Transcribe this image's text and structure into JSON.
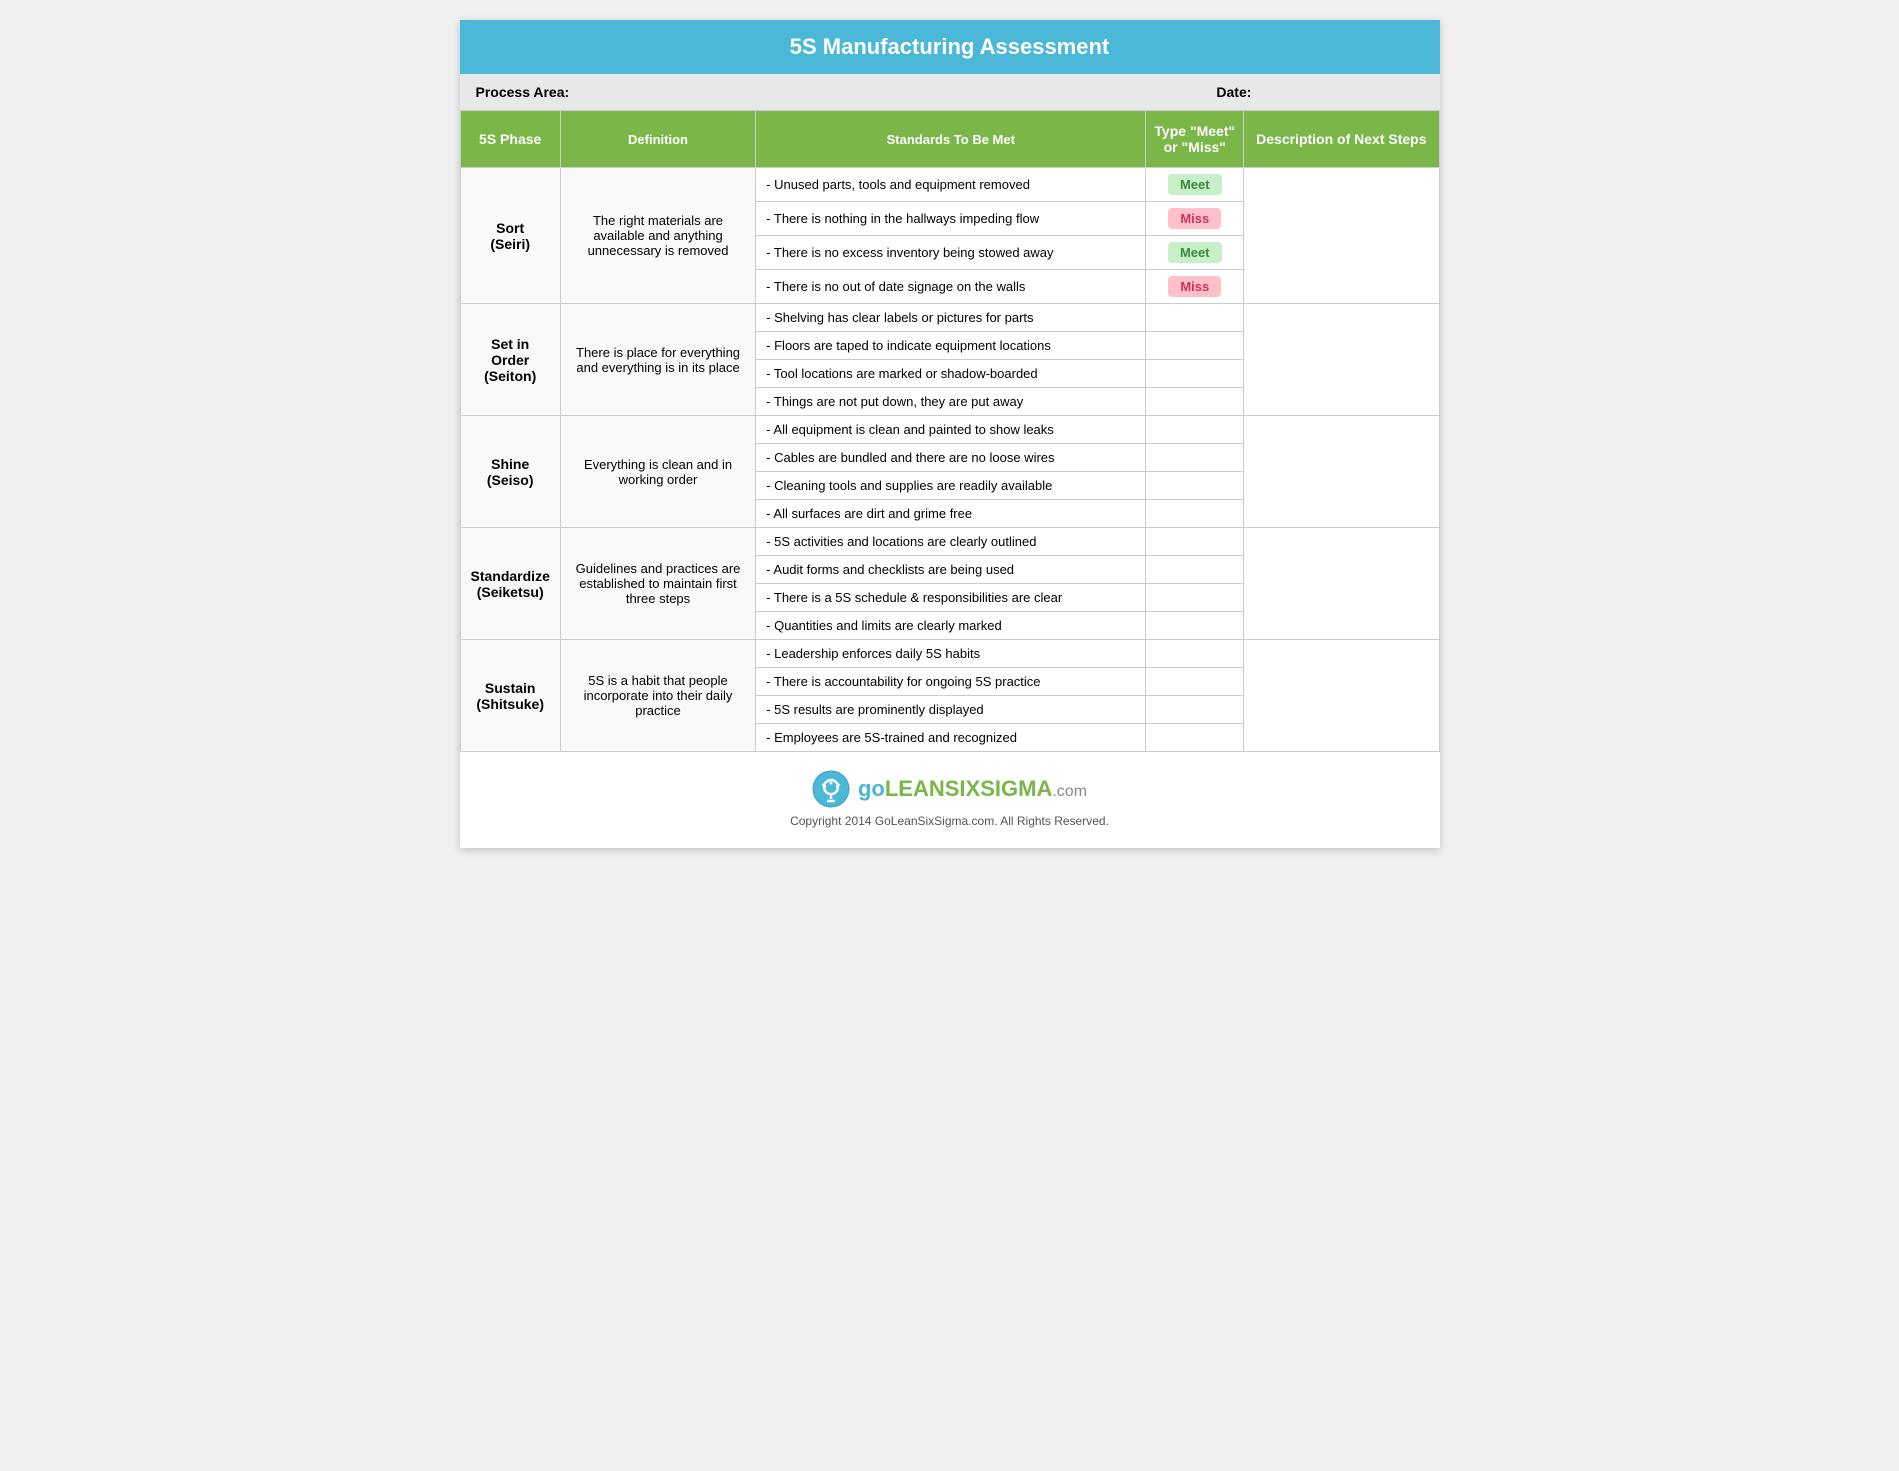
{
  "title": "5S Manufacturing Assessment",
  "meta": {
    "process_label": "Process Area:",
    "date_label": "Date:"
  },
  "headers": {
    "phase": "5S Phase",
    "definition": "Definition",
    "standards": "Standards To Be Met",
    "meet_miss": "Type \"Meet\" or \"Miss\"",
    "next_steps": "Description of Next Steps"
  },
  "phases": [
    {
      "name": "Sort\n(Seiri)",
      "definition": "The right materials are available and anything unnecessary is removed",
      "standards": [
        {
          "text": "- Unused parts, tools and equipment removed",
          "status": "Meet"
        },
        {
          "text": "- There is nothing in the hallways impeding flow",
          "status": "Miss"
        },
        {
          "text": "- There is no excess inventory being stowed away",
          "status": "Meet"
        },
        {
          "text": "- There is no out of date signage on the walls",
          "status": "Miss"
        }
      ]
    },
    {
      "name": "Set in Order\n(Seiton)",
      "definition": "There is place for everything and everything is in its place",
      "standards": [
        {
          "text": "- Shelving has clear labels or pictures for parts",
          "status": ""
        },
        {
          "text": "- Floors are taped to indicate equipment locations",
          "status": ""
        },
        {
          "text": "- Tool locations are marked or shadow-boarded",
          "status": ""
        },
        {
          "text": "- Things are not put down, they are put away",
          "status": ""
        }
      ]
    },
    {
      "name": "Shine\n(Seiso)",
      "definition": "Everything is clean and in working order",
      "standards": [
        {
          "text": "- All equipment is clean and painted to show leaks",
          "status": ""
        },
        {
          "text": "- Cables are bundled and there are no loose wires",
          "status": ""
        },
        {
          "text": "- Cleaning tools and supplies are readily available",
          "status": ""
        },
        {
          "text": "- All surfaces are dirt and grime free",
          "status": ""
        }
      ]
    },
    {
      "name": "Standardize\n(Seiketsu)",
      "definition": "Guidelines and practices are established to maintain first three steps",
      "standards": [
        {
          "text": "- 5S activities and locations are clearly outlined",
          "status": ""
        },
        {
          "text": "- Audit forms and checklists are being used",
          "status": ""
        },
        {
          "text": "- There is a 5S schedule & responsibilities are clear",
          "status": ""
        },
        {
          "text": "- Quantities and limits are clearly marked",
          "status": ""
        }
      ]
    },
    {
      "name": "Sustain\n(Shitsuke)",
      "definition": "5S is a habit that people incorporate into their daily practice",
      "standards": [
        {
          "text": "- Leadership enforces daily 5S habits",
          "status": ""
        },
        {
          "text": "- There is accountability for ongoing 5S practice",
          "status": ""
        },
        {
          "text": "- 5S results are prominently displayed",
          "status": ""
        },
        {
          "text": "- Employees are 5S-trained and recognized",
          "status": ""
        }
      ]
    }
  ],
  "footer": {
    "logo_go": "GO",
    "logo_lean": "LEAN",
    "logo_six": "SIX",
    "logo_sigma": "SIGMA",
    "logo_com": ".com",
    "copyright": "Copyright 2014 GoLeanSixSigma.com. All Rights Reserved."
  }
}
